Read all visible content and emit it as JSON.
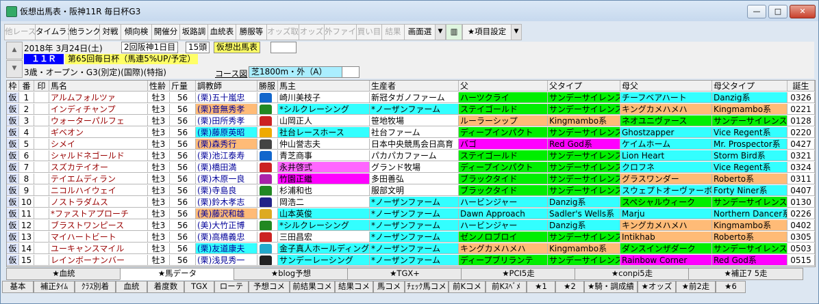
{
  "window": {
    "title": "仮想出馬表・阪神11R 毎日杯G3"
  },
  "toolbar": {
    "buttons": [
      {
        "label": "他レース",
        "enabled": false
      },
      {
        "label": "タイムランク",
        "enabled": true
      },
      {
        "label": "他ランク",
        "enabled": true
      },
      {
        "label": "対戦",
        "enabled": true
      },
      {
        "label": "傾向検",
        "enabled": true
      },
      {
        "label": "開催分",
        "enabled": true
      },
      {
        "label": "坂路調",
        "enabled": true
      },
      {
        "label": "血統表",
        "enabled": true
      },
      {
        "label": "勝服等",
        "enabled": true
      },
      {
        "label": "オッズ取",
        "enabled": false
      },
      {
        "label": "オッズ",
        "enabled": false
      },
      {
        "label": "外ファイル",
        "enabled": false
      },
      {
        "label": "買い目",
        "enabled": false
      },
      {
        "label": "結果",
        "enabled": false
      },
      {
        "label": "画面選",
        "enabled": true
      },
      {
        "label": "★項目設定",
        "enabled": true
      }
    ]
  },
  "race": {
    "date": "2018年  3月24日(土)",
    "meeting": "2回阪神1日目",
    "entries": "15頭",
    "mode": "仮想出馬表",
    "race_no": "１１Ｒ",
    "race_name": "第65回毎日杯（馬連5%UP/予定）",
    "conditions": "3歳・オープン・G3(別定)(国際)(特指)",
    "course_label": "コース図",
    "course": "芝1800m・外（A）"
  },
  "table": {
    "headers": [
      "枠",
      "番",
      "印",
      "馬名",
      "性齢",
      "斤量",
      "調教師",
      "勝服",
      "馬主",
      "生産者",
      "父",
      "父タイプ",
      "母父",
      "母父タイプ",
      "誕生"
    ],
    "rows": [
      {
        "waku": "仮",
        "num": "1",
        "horse": "アルムフォルツァ",
        "sexage": "牡3",
        "weight": "56",
        "trainer": "(栗)五十嵐忠",
        "owner": "崎川美枝子",
        "breeder": "新冠タガノファーム",
        "sire": "ハーツクライ",
        "sire_type": "サンデーサイレンス系",
        "dam_sire": "チーフベアハート",
        "dam_sire_type": "Danzig系",
        "birth": "0326",
        "mark": ""
      },
      {
        "waku": "仮",
        "num": "2",
        "horse": "インディチャンプ",
        "sexage": "牡3",
        "weight": "56",
        "trainer": "(栗)音無秀孝",
        "owner": "*シルクレーシング",
        "breeder": "*ノーザンファーム",
        "sire": "ステイゴールド",
        "sire_type": "サンデーサイレンス系",
        "dam_sire": "キングカメハメハ",
        "dam_sire_type": "Kingmambo系",
        "birth": "0221",
        "mark": ""
      },
      {
        "waku": "仮",
        "num": "3",
        "horse": "ウォーターパルフェ",
        "sexage": "牡3",
        "weight": "56",
        "trainer": "(栗)田所秀孝",
        "owner": "山岡正人",
        "breeder": "笹地牧場",
        "sire": "ルーラーシップ",
        "sire_type": "Kingmambo系",
        "dam_sire": "ネオユニヴァース",
        "dam_sire_type": "サンデーサイレンス系",
        "birth": "0128",
        "mark": ""
      },
      {
        "waku": "仮",
        "num": "4",
        "horse": "ギベオン",
        "sexage": "牡3",
        "weight": "56",
        "trainer": "(栗)藤原英昭",
        "owner": "社台レースホース",
        "breeder": "社台ファーム",
        "sire": "ディープインパクト",
        "sire_type": "サンデーサイレンス系",
        "dam_sire": "Ghostzapper",
        "dam_sire_type": "Vice Regent系",
        "birth": "0220",
        "mark": ""
      },
      {
        "waku": "仮",
        "num": "5",
        "horse": "シメイ",
        "sexage": "牡3",
        "weight": "56",
        "trainer": "(栗)森秀行",
        "owner": "仲山誉志夫",
        "breeder": "日本中央競馬会日高育",
        "sire": "バゴ",
        "sire_type": "Red God系",
        "dam_sire": "ケイムホーム",
        "dam_sire_type": "Mr. Prospector系",
        "birth": "0427",
        "mark": ""
      },
      {
        "waku": "仮",
        "num": "6",
        "horse": "シャルドネゴールド",
        "sexage": "牡3",
        "weight": "56",
        "trainer": "(栗)池江泰寿",
        "owner": "青芝商事",
        "breeder": "パカパカファーム",
        "sire": "ステイゴールド",
        "sire_type": "サンデーサイレンス系",
        "dam_sire": "Lion Heart",
        "dam_sire_type": "Storm Bird系",
        "birth": "0321",
        "mark": ""
      },
      {
        "waku": "仮",
        "num": "7",
        "horse": "スズカテイオー",
        "sexage": "牡3",
        "weight": "56",
        "trainer": "(栗)橋田満",
        "owner": "永井啓弍",
        "breeder": "グランド牧場",
        "sire": "ディープインパクト",
        "sire_type": "サンデーサイレンス系",
        "dam_sire": "クロフネ",
        "dam_sire_type": "Vice Regent系",
        "birth": "0324",
        "mark": ""
      },
      {
        "waku": "仮",
        "num": "8",
        "horse": "テイエムディラン",
        "sexage": "牡3",
        "weight": "56",
        "trainer": "(栗)木原一良",
        "owner": "竹園正繼",
        "breeder": "多田善弘",
        "sire": "ブラックタイド",
        "sire_type": "サンデーサイレンス系",
        "dam_sire": "グラスワンダー",
        "dam_sire_type": "Roberto系",
        "birth": "0311",
        "mark": ""
      },
      {
        "waku": "仮",
        "num": "9",
        "horse": "ニコルハイウェイ",
        "sexage": "牡3",
        "weight": "56",
        "trainer": "(栗)寺島良",
        "owner": "杉浦和也",
        "breeder": "服部文明",
        "sire": "ブラックタイド",
        "sire_type": "サンデーサイレンス系",
        "dam_sire": "スウェプトオーヴァーボード",
        "dam_sire_type": "Forty Niner系",
        "birth": "0407",
        "mark": ""
      },
      {
        "waku": "仮",
        "num": "10",
        "horse": "ノストラダムス",
        "sexage": "牡3",
        "weight": "56",
        "trainer": "(栗)鈴木孝志",
        "owner": "岡浩二",
        "breeder": "*ノーザンファーム",
        "sire": "ハービンジャー",
        "sire_type": "Danzig系",
        "dam_sire": "スペシャルウィーク",
        "dam_sire_type": "サンデーサイレンス系",
        "birth": "0130",
        "mark": ""
      },
      {
        "waku": "仮",
        "num": "11",
        "horse": "*ファストアプローチ",
        "sexage": "牡3",
        "weight": "56",
        "trainer": "(美)藤沢和雄",
        "owner": "山本英俊",
        "breeder": "*ノーザンファーム",
        "sire": "Dawn Approach",
        "sire_type": "Sadler's Wells系",
        "dam_sire": "Marju",
        "dam_sire_type": "Northern Dancer系",
        "birth": "0226",
        "mark": ""
      },
      {
        "waku": "仮",
        "num": "12",
        "horse": "ブラストワンピース",
        "sexage": "牡3",
        "weight": "56",
        "trainer": "(美)大竹正博",
        "owner": "*シルクレーシング",
        "breeder": "*ノーザンファーム",
        "sire": "ハービンジャー",
        "sire_type": "Danzig系",
        "dam_sire": "キングカメハメハ",
        "dam_sire_type": "Kingmambo系",
        "birth": "0402",
        "mark": ""
      },
      {
        "waku": "仮",
        "num": "13",
        "horse": "マイハートビート",
        "sexage": "牡3",
        "weight": "56",
        "trainer": "(栗)高橋義忠",
        "owner": "三田昌宏",
        "breeder": "*ノーザンファーム",
        "sire": "ゼンノロブロイ",
        "sire_type": "サンデーサイレンス系",
        "dam_sire": "Intikhab",
        "dam_sire_type": "Roberto系",
        "birth": "0305",
        "mark": ""
      },
      {
        "waku": "仮",
        "num": "14",
        "horse": "ユーキャンスマイル",
        "sexage": "牡3",
        "weight": "56",
        "trainer": "(栗)友道康夫",
        "owner": "金子真人ホールディング",
        "breeder": "*ノーザンファーム",
        "sire": "キングカメハメハ",
        "sire_type": "Kingmambo系",
        "dam_sire": "ダンスインザダーク",
        "dam_sire_type": "サンデーサイレンス系",
        "birth": "0503",
        "mark": ""
      },
      {
        "waku": "仮",
        "num": "15",
        "horse": "レインボーナンバー",
        "sexage": "牡3",
        "weight": "56",
        "trainer": "(栗)浅見秀一",
        "owner": "サンデーレーシング",
        "breeder": "*ノーザンファーム",
        "sire": "ディープブリランテ",
        "sire_type": "サンデーサイレンス系",
        "dam_sire": "Rainbow Corner",
        "dam_sire_type": "Red God系",
        "birth": "0515",
        "mark": ""
      }
    ]
  },
  "tabs_top": [
    "★血統",
    "★馬データ",
    "★blog予想",
    "★TGX+",
    "★PCI5走",
    "★conpi5走",
    "★補正7 5走"
  ],
  "tabs_bottom": [
    "基本",
    "補正ﾀｲﾑ",
    "ｸﾗｽ別着",
    "血統",
    "着度数",
    "TGX",
    "ローテ",
    "予想コメ",
    "前結果コメ",
    "結果コメ",
    "馬コメ",
    "ﾁｪｯｸ馬コメ",
    "前Kコメ",
    "前Kｽﾍﾞﾒ",
    "★1",
    "★2",
    "★騎・調成績",
    "★オッズ",
    "★前2走",
    "★6"
  ],
  "colors": {
    "cyan": "#33ffff",
    "green": "#00ee00",
    "magenta": "#ff00ff",
    "orange": "#ffbb77",
    "pink": "#ff66ff",
    "yellow_title": "#ffff66",
    "race_no_bg": "#0000ff",
    "horse_name": "#990000",
    "trainer_blue": "#000099",
    "waku_bg": "#ffcccc"
  }
}
